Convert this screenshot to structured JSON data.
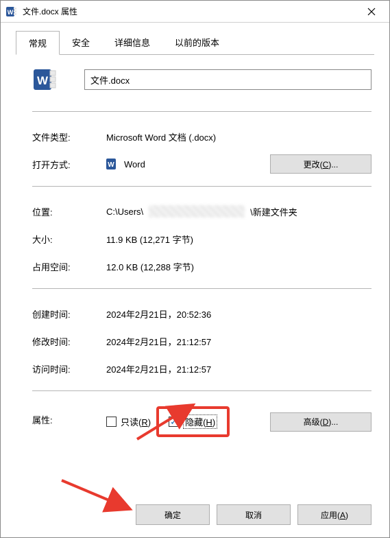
{
  "window": {
    "title": "文件.docx 属性"
  },
  "tabs": {
    "general": "常规",
    "security": "安全",
    "details": "详细信息",
    "previous": "以前的版本"
  },
  "file": {
    "name": "文件.docx"
  },
  "labels": {
    "file_type": "文件类型:",
    "open_with": "打开方式:",
    "location": "位置:",
    "size": "大小:",
    "size_on_disk": "占用空间:",
    "created": "创建时间:",
    "modified": "修改时间:",
    "accessed": "访问时间:",
    "attributes": "属性:"
  },
  "values": {
    "file_type": "Microsoft Word 文档 (.docx)",
    "open_with": "Word",
    "location_prefix": "C:\\Users\\",
    "location_suffix": "\\新建文件夹",
    "size": "11.9 KB (12,271 字节)",
    "size_on_disk": "12.0 KB (12,288 字节)",
    "created": "2024年2月21日，20:52:36",
    "modified": "2024年2月21日，21:12:57",
    "accessed": "2024年2月21日，21:12:57"
  },
  "buttons": {
    "change": "更改(",
    "change_u": "C",
    "change_tail": ")...",
    "advanced": "高级(",
    "advanced_u": "D",
    "advanced_tail": ")...",
    "ok": "确定",
    "cancel": "取消",
    "apply": "应用(",
    "apply_u": "A",
    "apply_tail": ")"
  },
  "checks": {
    "readonly": "只读(",
    "readonly_u": "R",
    "readonly_tail": ")",
    "hidden": "隐藏(",
    "hidden_u": "H",
    "hidden_tail": ")",
    "readonly_checked": false,
    "hidden_checked": true
  },
  "colors": {
    "highlight_red": "#e83a2e",
    "check_blue": "#1a6fb7"
  }
}
